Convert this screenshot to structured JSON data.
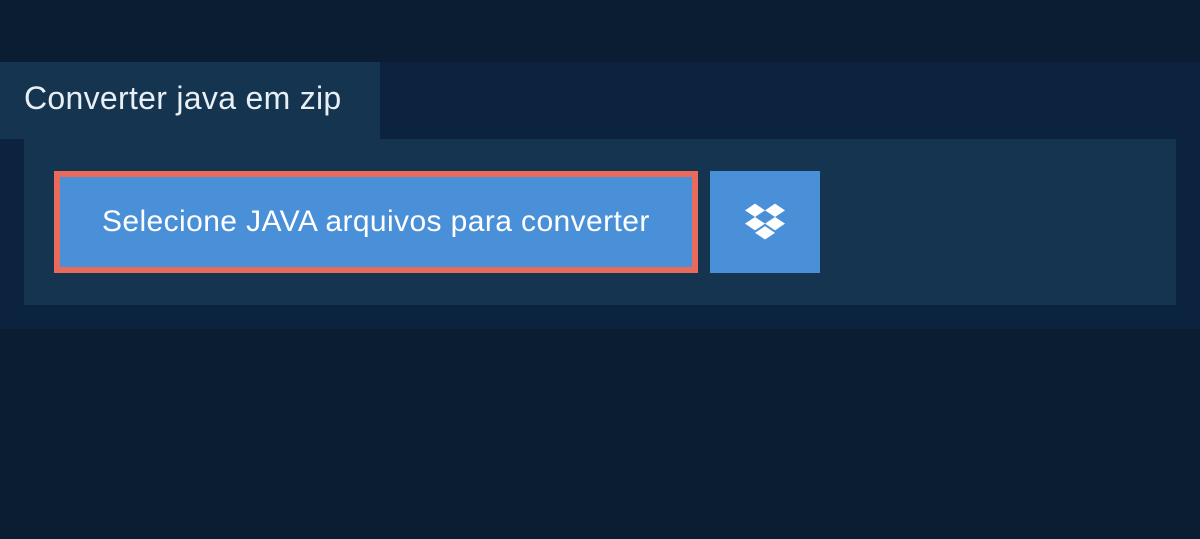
{
  "header": {
    "tab_label": "Converter java em zip"
  },
  "upload": {
    "select_button_label": "Selecione JAVA arquivos para converter",
    "dropbox_icon_name": "dropbox-icon"
  },
  "colors": {
    "page_bg": "#0c2340",
    "panel_bg": "#14344f",
    "bar_bg": "#0a1d33",
    "button_bg": "#4a90d9",
    "highlight_border": "#e76a5b",
    "text_light": "#e8eff5",
    "text_white": "#ffffff"
  }
}
